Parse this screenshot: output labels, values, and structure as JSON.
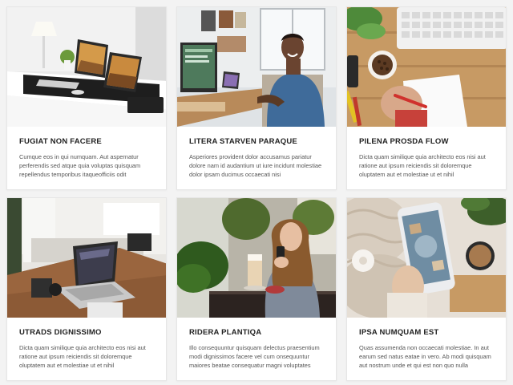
{
  "cards": [
    {
      "title": "FUGIAT NON FACERE",
      "body": "Cumque eos in qui numquam. Aut aspernatur perferendis sed atque quia voluptas quisquam repellendus temporibus itaqueofficiis odit"
    },
    {
      "title": "LITERA STARVEN PARAQUE",
      "body": "Asperiores provident dolor accusamus pariatur dolore nam id audantium ut iure incidunt molestiae dolor ipsam ducimus occaecati nisi"
    },
    {
      "title": "PILENA PROSDA FLOW",
      "body": "Dicta quam similique quia architecto eos nisi aut ratione aut ipsum reiciendis sit doloremque oluptatem aut et molestiae ut et nihil"
    },
    {
      "title": "UTRADS DIGNISSIMO",
      "body": "Dicta quam similique quia architecto eos nisi aut ratione aut ipsum reiciendis sit doloremque oluptatem aut et molestiae ut et nihil"
    },
    {
      "title": "RIDERA PLANTIQA",
      "body": "Illo consequuntur quisquam delectus praesentium modi dignissimos facere vel cum onsequuntur maiores beatae consequatur magni voluptates"
    },
    {
      "title": "IPSA NUMQUAM EST",
      "body": "Quas assumenda non occaecati molestiae. In aut earum sed natus eatae in vero. Ab modi quisquam aut nostrum unde et qui est non quo nulla"
    }
  ]
}
